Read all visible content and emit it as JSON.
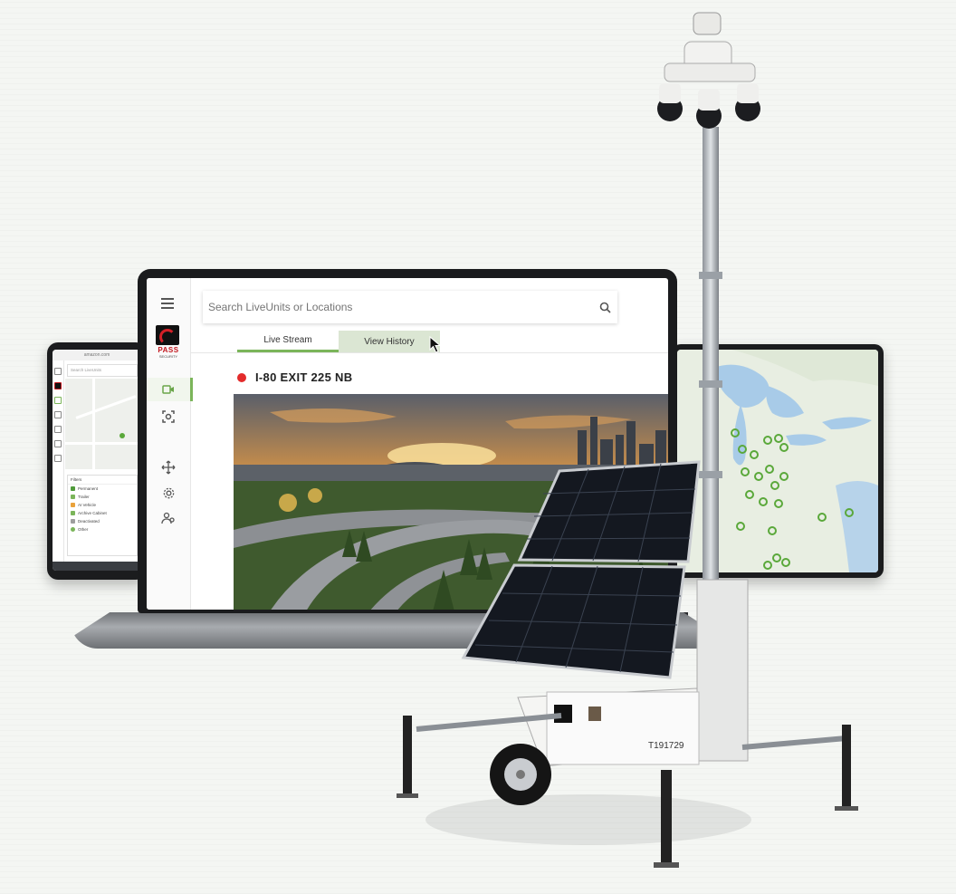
{
  "phone": {
    "url": "amazon.com",
    "search_placeholder": "Search LiveUnits",
    "filters_title": "Filters",
    "filters": [
      {
        "label": "Permanent",
        "color": "#4f9a3a"
      },
      {
        "label": "Trailer",
        "color": "#7bb55a"
      },
      {
        "label": "AI Vehicle",
        "color": "#e9a23b"
      },
      {
        "label": "Archive Cabinet",
        "color": "#7bb55a"
      },
      {
        "label": "Deactivated",
        "color": "#9e9e9e"
      },
      {
        "label": "Other",
        "color": "#7bb55a"
      }
    ]
  },
  "app": {
    "brand": "PASS",
    "brand_sub": "SECURITY",
    "search": {
      "placeholder": "Search LiveUnits or Locations"
    },
    "tabs": [
      {
        "label": "Live Stream"
      },
      {
        "label": "View History"
      }
    ],
    "unit": {
      "name": "I-80 EXIT 225 NB",
      "status_color": "#e32b2b"
    },
    "rail_icons": [
      "menu-icon",
      "camera-icon",
      "scan-icon",
      "move-icon",
      "gear-icon",
      "users-icon"
    ]
  },
  "trailer": {
    "id_label": "T191729",
    "brand": "PASS"
  },
  "colors": {
    "accent": "#7bb55a",
    "brand_red": "#c2161d"
  }
}
